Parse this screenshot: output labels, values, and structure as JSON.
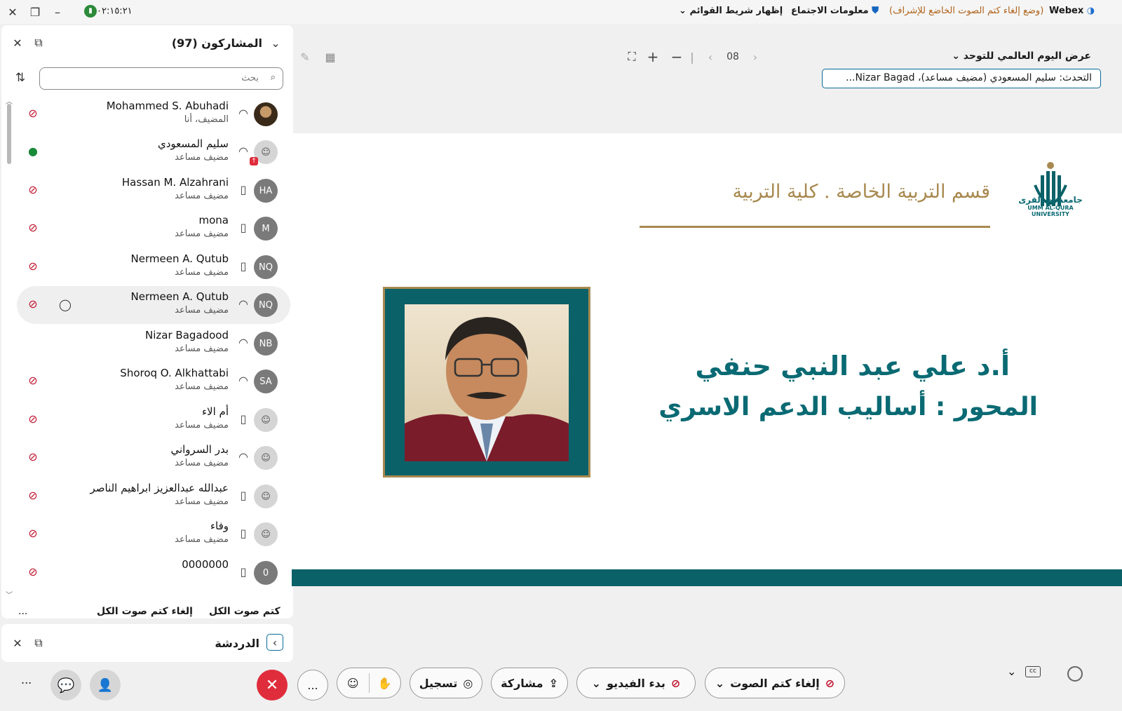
{
  "titlebar": {
    "app_name": "Webex",
    "mode_text": "(وضع إلغاء كتم الصوت الخاضع للإشراف)",
    "meeting_info": "معلومات الاجتماع",
    "show_menu": "إظهار شريط القوائم",
    "timer": "٠٢:١٥:٢١"
  },
  "participants": {
    "title": "المشاركون (97)",
    "search_placeholder": "بحث",
    "mute_all": "كتم صوت الكل",
    "unmute_all": "إلغاء كتم صوت الكل",
    "more": "...",
    "list": [
      {
        "name": "Mohammed S. Abuhadi",
        "role": "المضيف، أنا",
        "initials": "",
        "device": "headset",
        "mic": "muted"
      },
      {
        "name": "سليم المسعودي",
        "role": "مضيف مساعد",
        "initials": "",
        "device": "headset",
        "mic": "active"
      },
      {
        "name": "Hassan M. Alzahrani",
        "role": "مضيف مساعد",
        "initials": "HA",
        "device": "phone",
        "mic": "muted"
      },
      {
        "name": "mona",
        "role": "مضيف مساعد",
        "initials": "M",
        "device": "phone",
        "mic": "muted"
      },
      {
        "name": "Nermeen A. Qutub",
        "role": "مضيف مساعد",
        "initials": "NQ",
        "device": "phone",
        "mic": "muted"
      },
      {
        "name": "Nermeen A. Qutub",
        "role": "مضيف مساعد",
        "initials": "NQ",
        "device": "headset",
        "mic": "muted"
      },
      {
        "name": "Nizar Bagadood",
        "role": "مضيف مساعد",
        "initials": "NB",
        "device": "headset",
        "mic": "none"
      },
      {
        "name": "Shoroq O. Alkhattabi",
        "role": "مضيف مساعد",
        "initials": "SA",
        "device": "headset",
        "mic": "muted"
      },
      {
        "name": "أم الاء",
        "role": "مضيف مساعد",
        "initials": "",
        "device": "phone",
        "mic": "muted"
      },
      {
        "name": "بدر السرواني",
        "role": "مضيف مساعد",
        "initials": "",
        "device": "headset",
        "mic": "muted"
      },
      {
        "name": "عبدالله عبدالعزيز ابراهيم الناصر",
        "role": "مضيف مساعد",
        "initials": "",
        "device": "phone",
        "mic": "muted"
      },
      {
        "name": "وفاء",
        "role": "مضيف مساعد",
        "initials": "",
        "device": "phone",
        "mic": "muted"
      },
      {
        "name": "0000000",
        "role": "",
        "initials": "0",
        "device": "phone",
        "mic": "muted"
      }
    ]
  },
  "chat": {
    "title": "الدردشة"
  },
  "stage": {
    "layout_label": "عرض اليوم العالمي للتوحد",
    "page_number": "08",
    "speaker_text": "التحدث: سليم المسعودي (مضيف مساعد)، Nizar Bagad..."
  },
  "slide": {
    "department": "قسم التربية الخاصة . كلية التربية",
    "university_ar": "جامعة أم القرى",
    "university_en": "UMM AL-QURA UNIVERSITY",
    "presenter": "أ.د علي عبد النبي حنفي",
    "topic": "المحور : أساليب الدعم الاسري",
    "accent_teal": "#0b6168",
    "accent_gold": "#a8894f"
  },
  "controls": {
    "unmute": "إلغاء كتم الصوت",
    "start_video": "بدء الفيديو",
    "share": "مشاركة",
    "record": "تسجيل",
    "more": "...",
    "left_more": "...",
    "leave_color": "#e02d3c"
  }
}
